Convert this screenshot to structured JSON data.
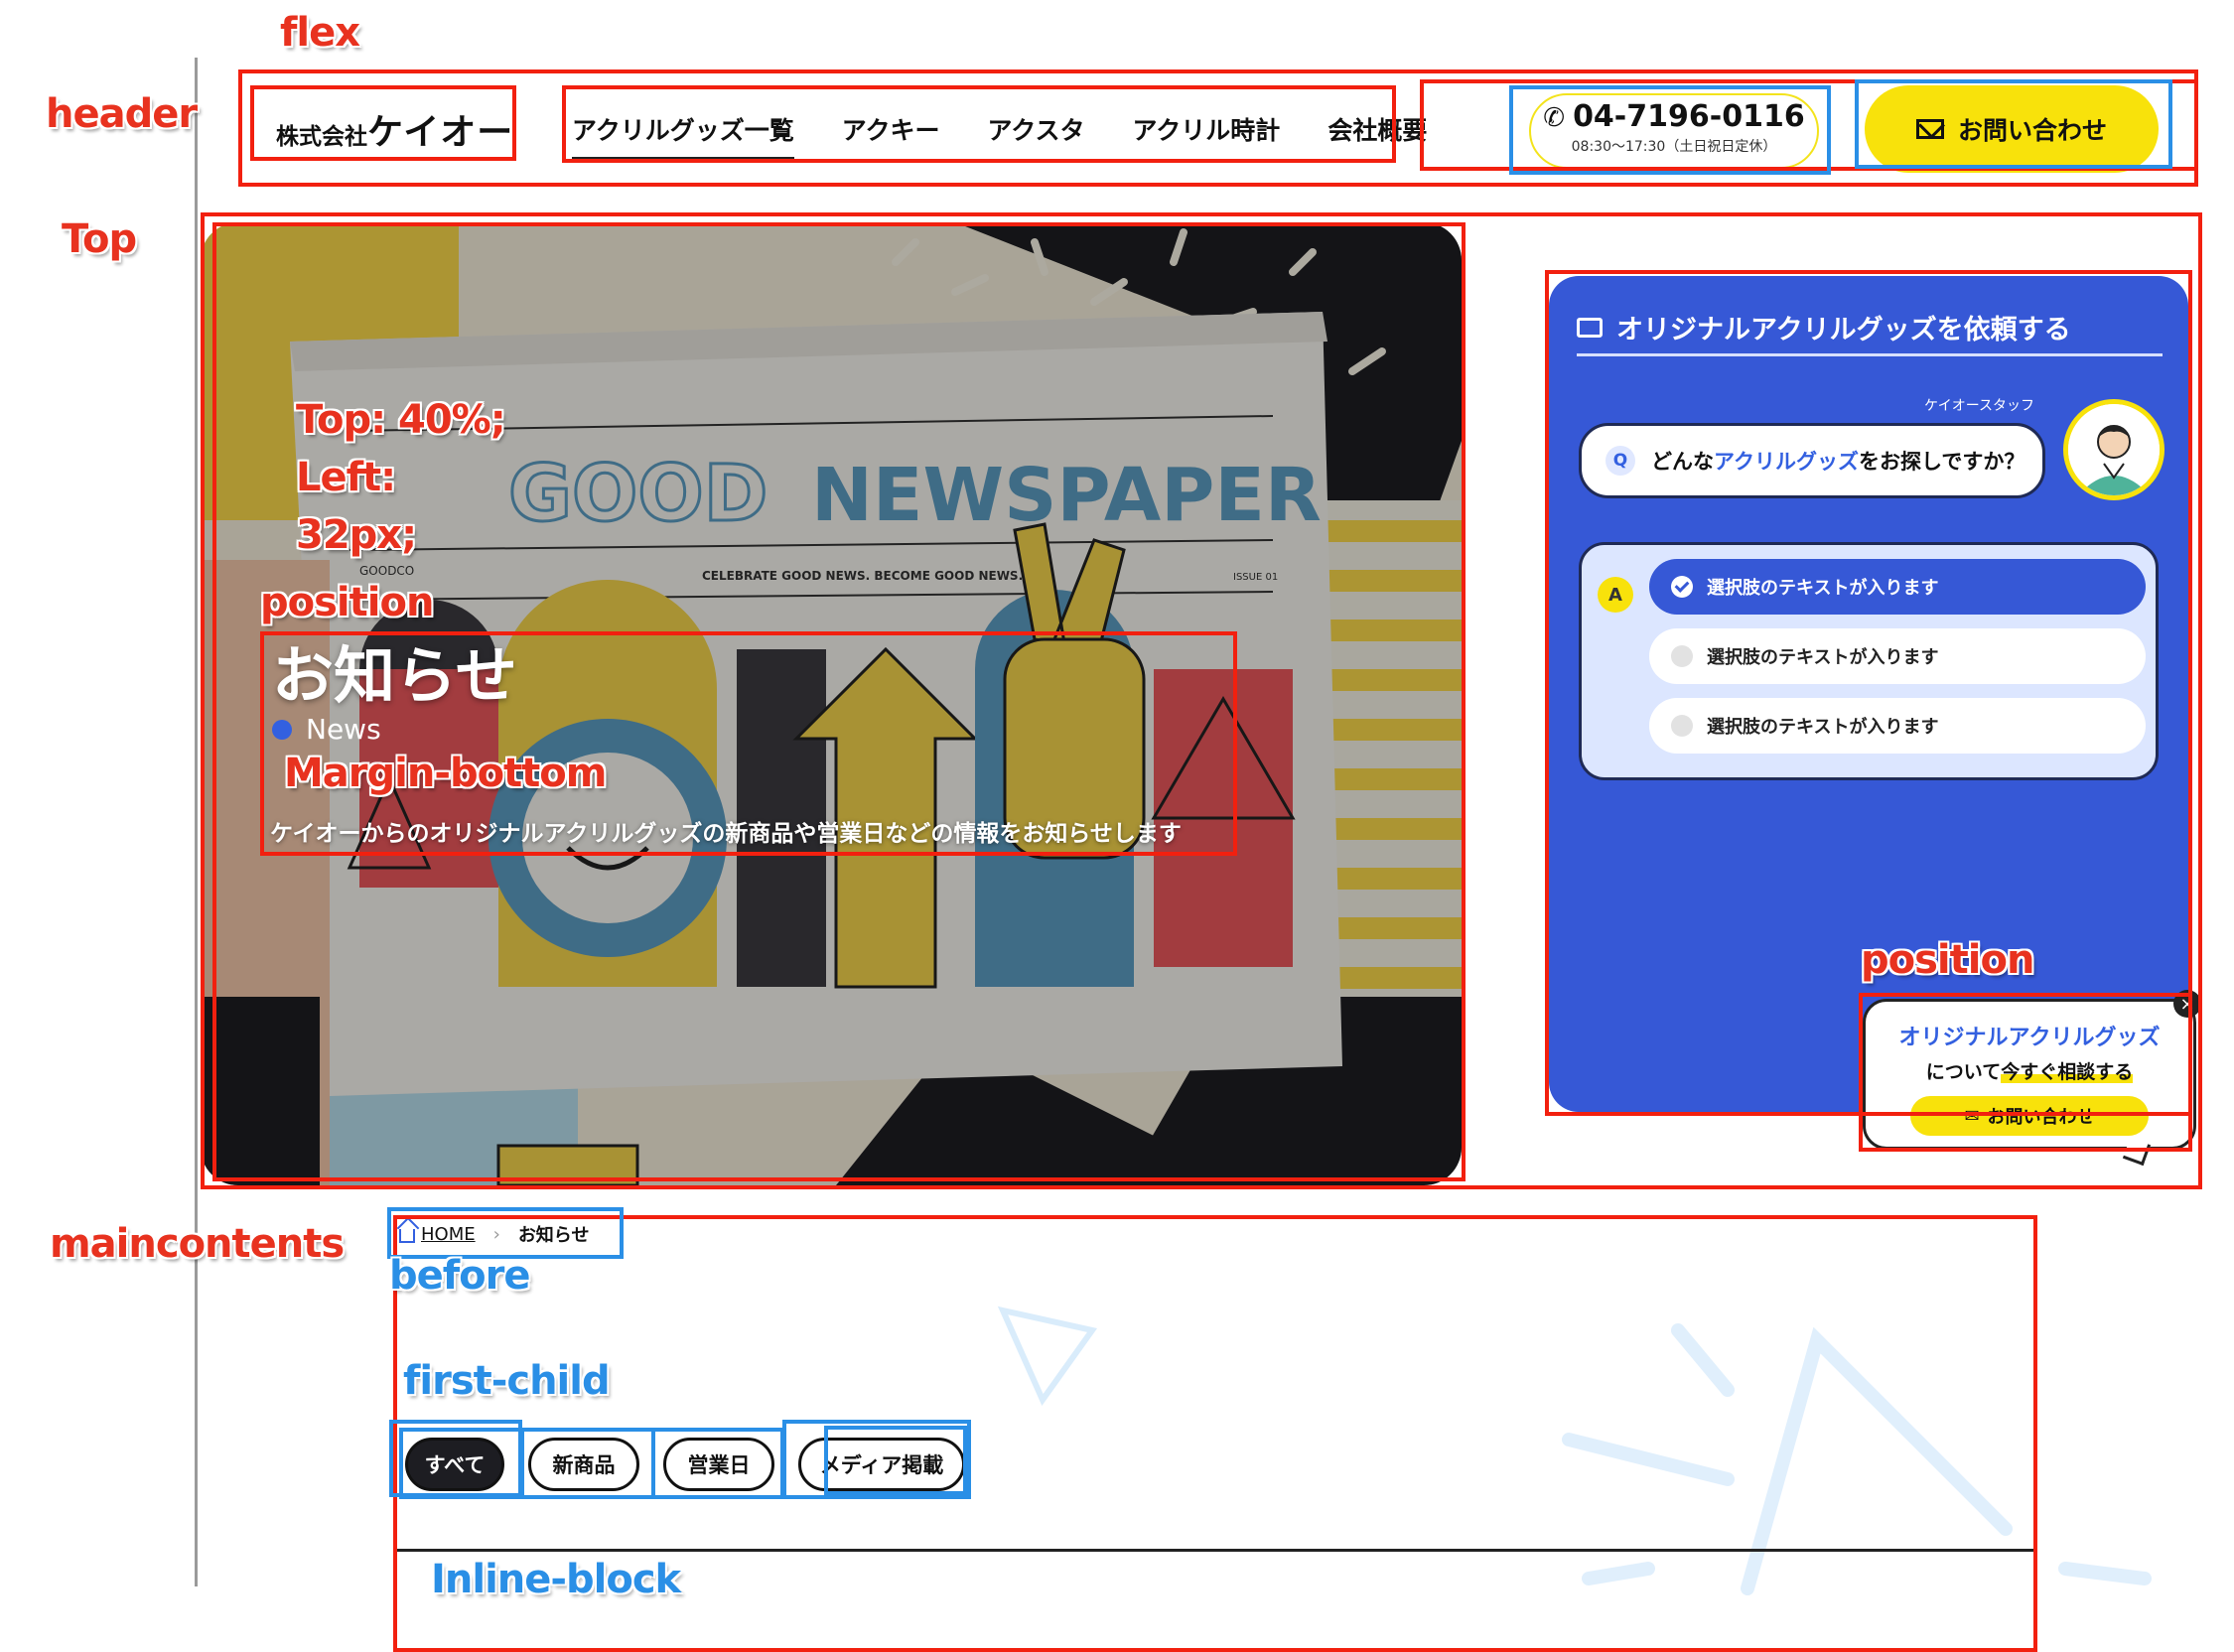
{
  "annotations": {
    "flex": "flex",
    "header": "header",
    "top": "Top",
    "hero_position_lines": [
      "Top: 40%;",
      "Left:",
      "32px;"
    ],
    "position": "position",
    "margin_bottom": "Margin-bottom",
    "panel_position": "position",
    "maincontents": "maincontents",
    "before": "before",
    "first_child": "first-child",
    "inline_block": "Inline-block"
  },
  "header": {
    "logo_small": "株式会社",
    "logo_big": "ケイオー",
    "nav": [
      "アクリルグッズ一覧",
      "アクキー",
      "アクスタ",
      "アクリル時計",
      "会社概要"
    ],
    "phone_number": "04-7196-0116",
    "phone_hours": "08:30〜17:30（土日祝日定休）",
    "contact_label": "お問い合わせ"
  },
  "hero": {
    "title": "お知らせ",
    "subtitle": "News",
    "description": "ケイオーからのオリジナルアクリルグッズの新商品や営業日などの情報をお知らせします",
    "image_text": {
      "masthead_left": "GOOD",
      "masthead_right": "NEWSPAPER",
      "tagline": "CELEBRATE GOOD NEWS. BECOME GOOD NEWS.",
      "issue": "ISSUE 01",
      "brand": "GOODCO"
    }
  },
  "panel": {
    "title": "オリジナルアクリルグッズを依頼する",
    "staff_label": "ケイオースタッフ",
    "question_badge": "Q",
    "question_pre": "どんな",
    "question_highlight": "アクリルグッズ",
    "question_post": "をお探しですか？",
    "answer_badge": "A",
    "options": [
      "選択肢のテキストが入ります",
      "選択肢のテキストが入ります",
      "選択肢のテキストが入ります"
    ]
  },
  "consult_card": {
    "line1": "オリジナルアクリルグッズ",
    "line2_pre": "について",
    "line2_highlight": "今すぐ相談する",
    "button_label": "お問い合わせ",
    "close_icon": "×"
  },
  "breadcrumb": {
    "home": "HOME",
    "separator": "›",
    "current": "お知らせ"
  },
  "filters": [
    "すべて",
    "新商品",
    "営業日",
    "メディア掲載"
  ],
  "colors": {
    "annotation_red": "#f2200f",
    "annotation_blue": "#2a8fe6",
    "brand_yellow": "#f8e20b",
    "panel_blue": "#3658d6"
  }
}
